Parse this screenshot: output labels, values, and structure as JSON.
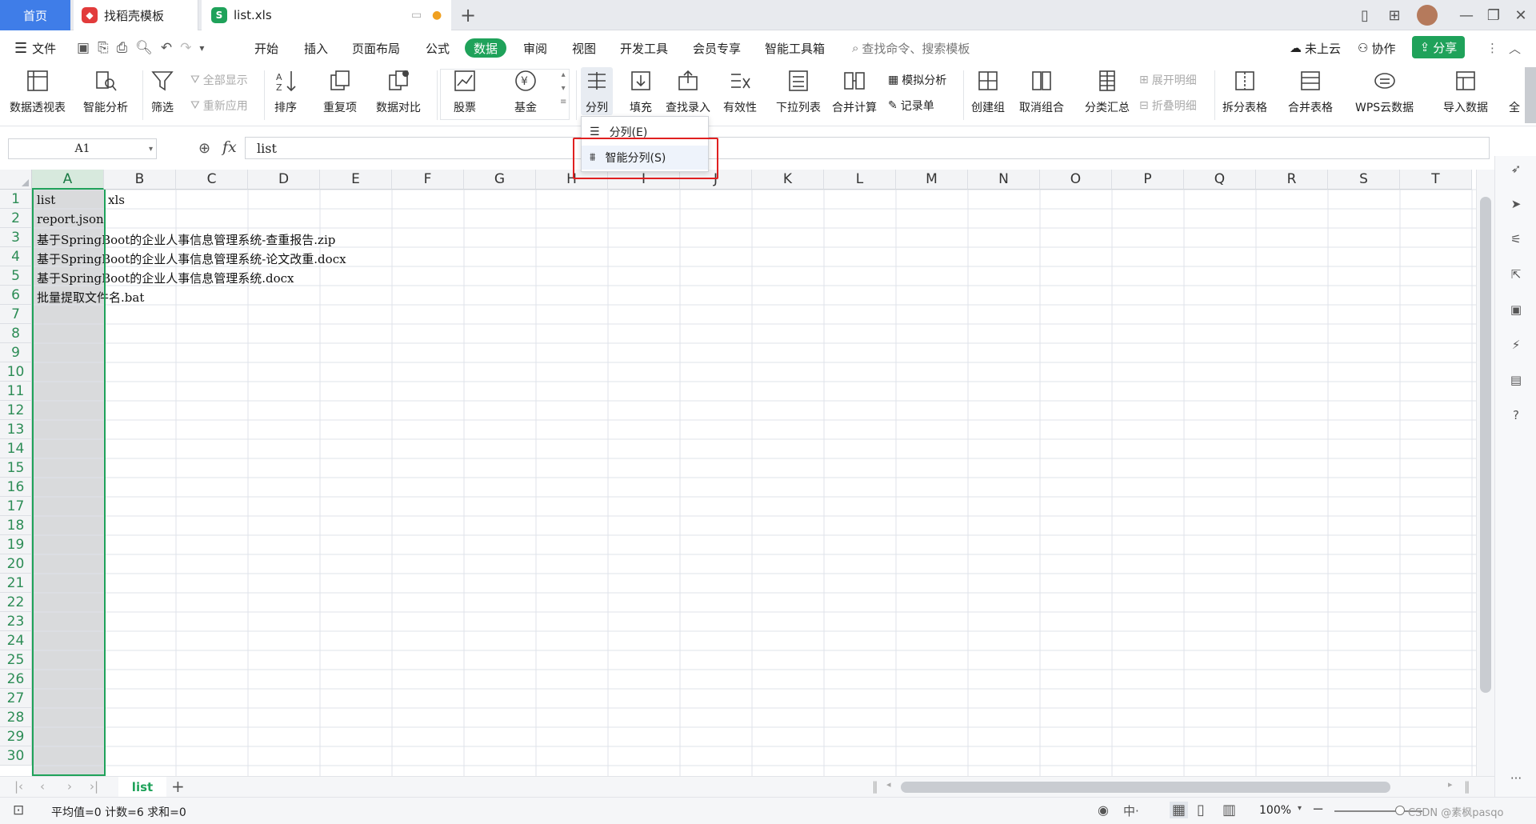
{
  "tabs": {
    "home": "首页",
    "template": "找稻壳模板",
    "file": "list.xls"
  },
  "menubar": {
    "file_label": "文件",
    "items": [
      "开始",
      "插入",
      "页面布局",
      "公式",
      "数据",
      "审阅",
      "视图",
      "开发工具",
      "会员专享",
      "智能工具箱"
    ],
    "active": "数据",
    "search_placeholder": "查找命令、搜索模板",
    "cloud_label": "未上云",
    "collab_label": "协作",
    "share_label": "分享"
  },
  "ribbon": {
    "pivot": "数据透视表",
    "smart_analysis": "智能分析",
    "filter": "筛选",
    "show_all": "全部显示",
    "reapply": "重新应用",
    "sort": "排序",
    "duplicates": "重复项",
    "compare": "数据对比",
    "stocks": "股票",
    "funds": "基金",
    "split": "分列",
    "fill": "填充",
    "find_entry": "查找录入",
    "validity": "有效性",
    "dropdown_list": "下拉列表",
    "consolidate": "合并计算",
    "what_if": "模拟分析",
    "record_form": "记录单",
    "group": "创建组",
    "ungroup": "取消组合",
    "subtotal": "分类汇总",
    "expand_detail": "展开明细",
    "collapse_detail": "折叠明细",
    "split_table": "拆分表格",
    "merge_table": "合并表格",
    "wps_cloud": "WPS云数据",
    "import_data": "导入数据",
    "more": "全"
  },
  "dropdown": {
    "item1": "分列(E)",
    "item2": "智能分列(S)"
  },
  "formula": {
    "name_box": "A1",
    "fx": "fx",
    "value": "list"
  },
  "grid": {
    "columns": [
      "A",
      "B",
      "C",
      "D",
      "E",
      "F",
      "G",
      "H",
      "I",
      "J",
      "K",
      "L",
      "M",
      "N",
      "O",
      "P",
      "Q",
      "R",
      "S",
      "T"
    ],
    "rows": [
      "1",
      "2",
      "3",
      "4",
      "5",
      "6",
      "7",
      "8",
      "9",
      "10",
      "11",
      "12",
      "13",
      "14",
      "15",
      "16",
      "17",
      "18",
      "19",
      "20",
      "21",
      "22",
      "23",
      "24",
      "25",
      "26",
      "27",
      "28",
      "29",
      "30"
    ],
    "cells": {
      "A1": "list",
      "B1": "xls",
      "A2": "report.json",
      "A3": "基于SpringBoot的企业人事信息管理系统-查重报告.zip",
      "A4": "基于SpringBoot的企业人事信息管理系统-论文改重.docx",
      "A5": "基于SpringBoot的企业人事信息管理系统.docx",
      "A6": "批量提取文件名.bat"
    }
  },
  "sheets": {
    "active": "list"
  },
  "status": {
    "summary": "平均值=0  计数=6  求和=0",
    "zoom": "100%",
    "watermark": "CSDN @素枫pasqo"
  },
  "colors": {
    "accent_green": "#1fa25a",
    "home_tab_blue": "#3f7de8",
    "highlight_red": "#e02020"
  }
}
